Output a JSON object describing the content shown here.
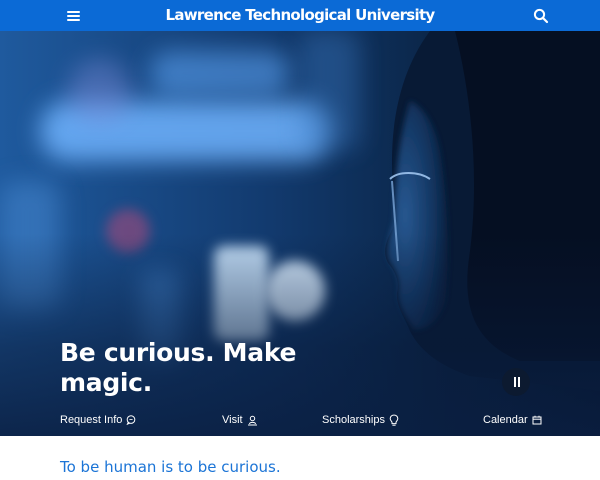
{
  "header": {
    "menu_icon": "hamburger-menu-icon",
    "logo_text": "Lawrence Technological University",
    "search_icon": "search-icon",
    "bg_color": "#0b6ad6"
  },
  "hero": {
    "headline": "Be curious. Make magic.",
    "pause_icon": "pause-icon",
    "quick_links": [
      {
        "label": "Request Info",
        "icon": "chat-bubble-icon"
      },
      {
        "label": "Visit",
        "icon": "location-person-icon"
      },
      {
        "label": "Scholarships",
        "icon": "lightbulb-icon"
      },
      {
        "label": "Calendar",
        "icon": "calendar-icon"
      }
    ]
  },
  "tagline": {
    "text": "To be human is to be curious.",
    "color": "#1b74d6"
  }
}
